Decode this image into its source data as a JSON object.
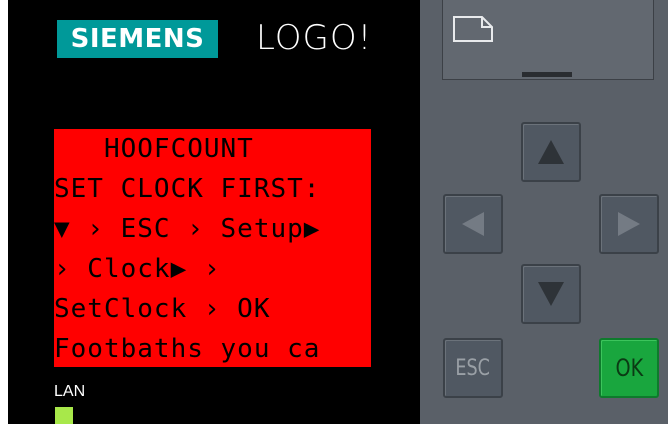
{
  "brand": {
    "logo_text": "SIEMENS",
    "product": "LOGO!"
  },
  "lcd": {
    "background": "#ff0000",
    "lines": [
      "   HOOFCOUNT",
      "SET CLOCK FIRST:",
      "▼ › ESC › Setup▶",
      "› Clock▶ ›",
      "SetClock › OK",
      "Footbaths you ca"
    ]
  },
  "status": {
    "lan_label": "LAN",
    "lan_led_color": "#a8e84a"
  },
  "buttons": {
    "up_icon": "triangle-up-icon",
    "left_icon": "triangle-left-icon",
    "right_icon": "triangle-right-icon",
    "down_icon": "triangle-down-icon",
    "esc_label": "ESC",
    "ok_label": "OK"
  },
  "colors": {
    "brand": "#009999",
    "ok": "#19a63e",
    "panel": "#5a6068"
  }
}
